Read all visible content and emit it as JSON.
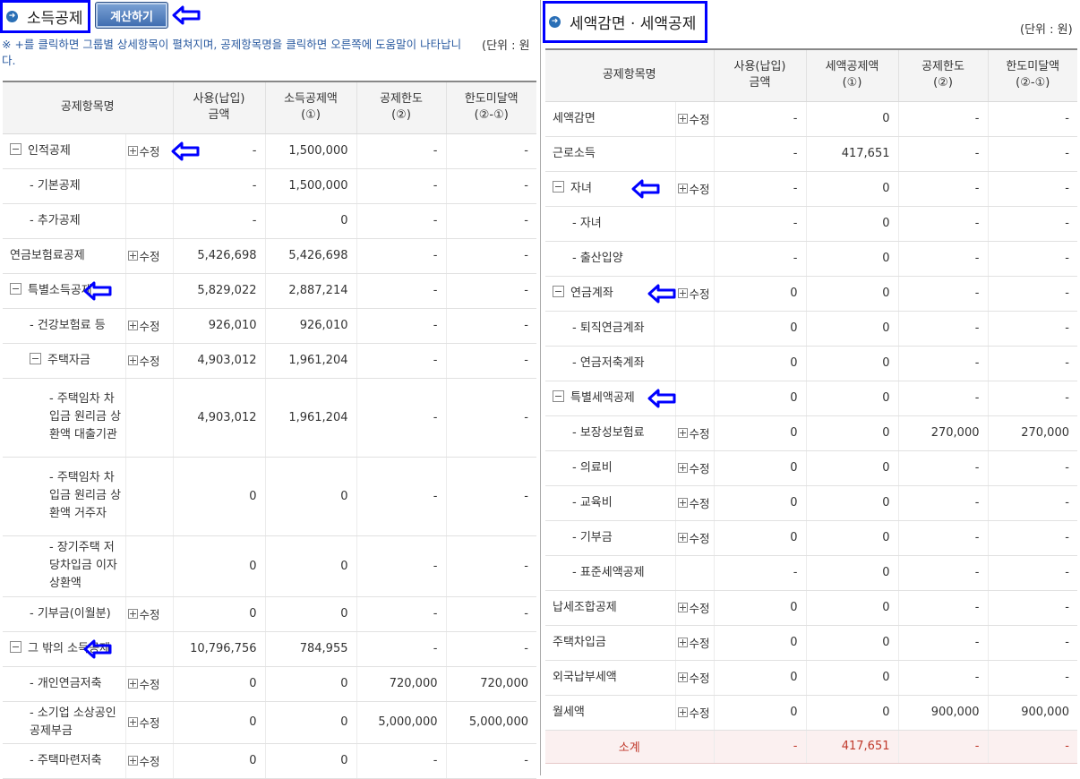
{
  "left": {
    "title": "소득공제",
    "calc_button": "계산하기",
    "unit": "(단위 : 원",
    "notice": "※ +를 클릭하면 그룹별 상세항목이 펼쳐지며, 공제항목명을 클릭하면 오른쪽에 도움말이 나타납니다.",
    "headers": [
      "공제항목명",
      "사용(납입)\n금액",
      "소득공제액\n(①)",
      "공제한도\n(②)",
      "한도미달액\n(②-①)"
    ],
    "edit_label": "수정",
    "rows": [
      {
        "name": "인적공제",
        "level": 0,
        "expand": true,
        "edit": true,
        "arrow": true,
        "paid": "-",
        "deduct": "1,500,000",
        "limit": "-",
        "under": "-"
      },
      {
        "name": "- 기본공제",
        "level": 1,
        "paid": "-",
        "deduct": "1,500,000",
        "limit": "-",
        "under": "-"
      },
      {
        "name": "- 추가공제",
        "level": 1,
        "paid": "-",
        "deduct": "0",
        "limit": "-",
        "under": "-"
      },
      {
        "name": "연금보험료공제",
        "level": 0,
        "edit": true,
        "paid": "5,426,698",
        "deduct": "5,426,698",
        "limit": "-",
        "under": "-"
      },
      {
        "name": "특별소득공제",
        "level": 0,
        "expand": true,
        "arrow": true,
        "paid": "5,829,022",
        "deduct": "2,887,214",
        "limit": "-",
        "under": "-"
      },
      {
        "name": "- 건강보험료 등",
        "level": 1,
        "edit": true,
        "paid": "926,010",
        "deduct": "926,010",
        "limit": "-",
        "under": "-"
      },
      {
        "name": "주택자금",
        "level": 1,
        "expand": true,
        "edit": true,
        "paid": "4,903,012",
        "deduct": "1,961,204",
        "limit": "-",
        "under": "-"
      },
      {
        "name": "- 주택임차 차입금 원리금 상환액 대출기관",
        "level": 2,
        "tall": 88,
        "paid": "4,903,012",
        "deduct": "1,961,204",
        "limit": "-",
        "under": "-"
      },
      {
        "name": "- 주택임차 차입금 원리금 상환액 거주자",
        "level": 2,
        "tall": 88,
        "paid": "0",
        "deduct": "0",
        "limit": "-",
        "under": "-"
      },
      {
        "name": "- 장기주택 저당차입금 이자상환액",
        "level": 2,
        "tall": 68,
        "paid": "0",
        "deduct": "0",
        "limit": "-",
        "under": "-"
      },
      {
        "name": "- 기부금(이월분)",
        "level": 1,
        "edit": true,
        "paid": "0",
        "deduct": "0",
        "limit": "-",
        "under": "-"
      },
      {
        "name": "그 밖의 소득공제",
        "level": 0,
        "expand": true,
        "arrow": true,
        "paid": "10,796,756",
        "deduct": "784,955",
        "limit": "-",
        "under": "-"
      },
      {
        "name": "- 개인연금저축",
        "level": 1,
        "edit": true,
        "paid": "0",
        "deduct": "0",
        "limit": "720,000",
        "under": "720,000"
      },
      {
        "name": "- 소기업 소상공인 공제부금",
        "level": 1,
        "edit": true,
        "tall": 47,
        "paid": "0",
        "deduct": "0",
        "limit": "5,000,000",
        "under": "5,000,000"
      },
      {
        "name": "- 주택마련저축",
        "level": 1,
        "edit": true,
        "paid": "0",
        "deduct": "0",
        "limit": "-",
        "under": "-"
      }
    ]
  },
  "right": {
    "title": "세액감면 · 세액공제",
    "unit": "(단위 : 원)",
    "headers": [
      "공제항목명",
      "사용(납입)\n금액",
      "세액공제액\n(①)",
      "공제한도\n(②)",
      "한도미달액\n(②-①)"
    ],
    "edit_label": "수정",
    "rows": [
      {
        "name": "세액감면",
        "level": 0,
        "edit": true,
        "paid": "-",
        "deduct": "0",
        "limit": "-",
        "under": "-"
      },
      {
        "name": "근로소득",
        "level": 0,
        "paid": "-",
        "deduct": "417,651",
        "limit": "-",
        "under": "-"
      },
      {
        "name": "자녀",
        "level": 0,
        "expand": true,
        "edit": true,
        "arrow": true,
        "paid": "-",
        "deduct": "0",
        "limit": "-",
        "under": "-"
      },
      {
        "name": "- 자녀",
        "level": 1,
        "paid": "-",
        "deduct": "0",
        "limit": "-",
        "under": "-"
      },
      {
        "name": "- 출산입양",
        "level": 1,
        "paid": "-",
        "deduct": "0",
        "limit": "-",
        "under": "-"
      },
      {
        "name": "연금계좌",
        "level": 0,
        "expand": true,
        "edit": true,
        "arrow": true,
        "paid": "0",
        "deduct": "0",
        "limit": "-",
        "under": "-"
      },
      {
        "name": "- 퇴직연금계좌",
        "level": 1,
        "paid": "0",
        "deduct": "0",
        "limit": "-",
        "under": "-"
      },
      {
        "name": "- 연금저축계좌",
        "level": 1,
        "paid": "0",
        "deduct": "0",
        "limit": "-",
        "under": "-"
      },
      {
        "name": "특별세액공제",
        "level": 0,
        "expand": true,
        "arrow": true,
        "paid": "0",
        "deduct": "0",
        "limit": "-",
        "under": "-"
      },
      {
        "name": "- 보장성보험료",
        "level": 1,
        "edit": true,
        "paid": "0",
        "deduct": "0",
        "limit": "270,000",
        "under": "270,000"
      },
      {
        "name": "- 의료비",
        "level": 1,
        "edit": true,
        "paid": "0",
        "deduct": "0",
        "limit": "-",
        "under": "-"
      },
      {
        "name": "- 교육비",
        "level": 1,
        "edit": true,
        "paid": "0",
        "deduct": "0",
        "limit": "-",
        "under": "-"
      },
      {
        "name": "- 기부금",
        "level": 1,
        "edit": true,
        "paid": "0",
        "deduct": "0",
        "limit": "-",
        "under": "-"
      },
      {
        "name": "- 표준세액공제",
        "level": 1,
        "paid": "-",
        "deduct": "0",
        "limit": "-",
        "under": "-"
      },
      {
        "name": "납세조합공제",
        "level": 0,
        "edit": true,
        "paid": "0",
        "deduct": "0",
        "limit": "-",
        "under": "-"
      },
      {
        "name": "주택차입금",
        "level": 0,
        "edit": true,
        "paid": "0",
        "deduct": "0",
        "limit": "-",
        "under": "-"
      },
      {
        "name": "외국납부세액",
        "level": 0,
        "edit": true,
        "paid": "0",
        "deduct": "0",
        "limit": "-",
        "under": "-"
      },
      {
        "name": "월세액",
        "level": 0,
        "edit": true,
        "paid": "0",
        "deduct": "0",
        "limit": "900,000",
        "under": "900,000"
      }
    ],
    "total": {
      "name": "소계",
      "paid": "-",
      "deduct": "417,651",
      "limit": "-",
      "under": "-"
    }
  },
  "colors": {
    "highlight_border": "#0000ff",
    "total_text": "#c0392b"
  }
}
